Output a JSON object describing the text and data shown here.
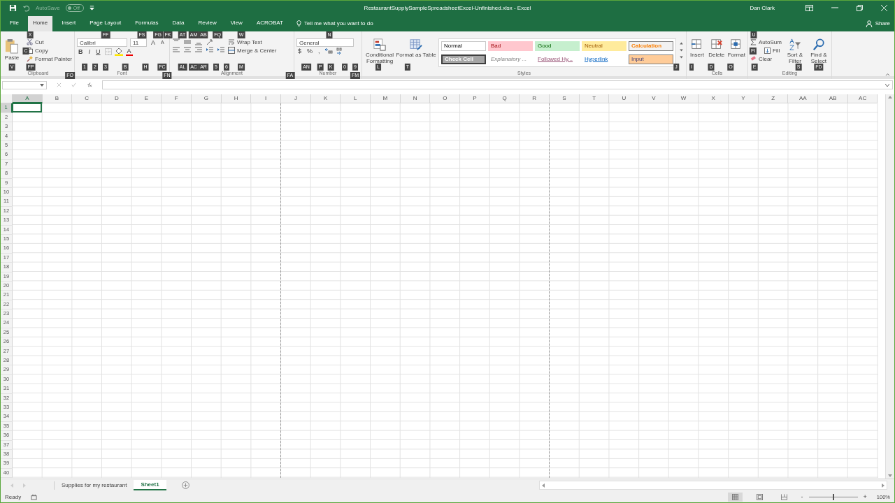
{
  "title_bar": {
    "autosave_label": "AutoSave",
    "autosave": {
      "label": "Off",
      "on": false
    },
    "title": "RestaurantSupplySampleSpreadsheetExcel-Unfinished.xlsx  -  Excel",
    "user": "Dan Clark"
  },
  "menu_tabs": [
    {
      "label": "File",
      "selected": false
    },
    {
      "label": "Home",
      "selected": true
    },
    {
      "label": "Insert",
      "selected": false
    },
    {
      "label": "Page Layout",
      "selected": false
    },
    {
      "label": "Formulas",
      "selected": false
    },
    {
      "label": "Data",
      "selected": false
    },
    {
      "label": "Review",
      "selected": false
    },
    {
      "label": "View",
      "selected": false
    },
    {
      "label": "ACROBAT",
      "selected": false
    }
  ],
  "tell_me": "Tell me what you want to do",
  "share": "Share",
  "clipboard": {
    "paste": "Paste",
    "cut": "Cut",
    "copy": "Copy",
    "format_painter": "Format Painter",
    "label": "Clipboard"
  },
  "font": {
    "name": "Calibri",
    "size": "11",
    "grow": "A",
    "shrink": "A",
    "bold": "B",
    "italic": "I",
    "underline": "U",
    "color_letter": "A",
    "label": "Font"
  },
  "alignment": {
    "wrap": "Wrap Text",
    "merge": "Merge & Center",
    "label": "Alignment"
  },
  "number": {
    "format": "General",
    "currency": "$",
    "percent": "%",
    "comma": ",",
    "label": "Number"
  },
  "styles": {
    "conditional": "Conditional Formatting",
    "format_table": "Format as Table",
    "label": "Styles",
    "gallery": [
      {
        "label": "Normal",
        "kind": "normal"
      },
      {
        "label": "Bad",
        "kind": "bad"
      },
      {
        "label": "Good",
        "kind": "good"
      },
      {
        "label": "Neutral",
        "kind": "neutral"
      },
      {
        "label": "Calculation",
        "kind": "calculation"
      },
      {
        "label": "Check Cell",
        "kind": "check"
      },
      {
        "label": "Explanatory ...",
        "kind": "explanatory"
      },
      {
        "label": "Followed Hy...",
        "kind": "followed"
      },
      {
        "label": "Hyperlink",
        "kind": "hyperlink"
      },
      {
        "label": "Input",
        "kind": "input"
      }
    ]
  },
  "cells": {
    "buttons": [
      "Insert",
      "Delete",
      "Format"
    ],
    "label": "Cells"
  },
  "editing": {
    "autosum": "AutoSum",
    "fill": "Fill",
    "clear": "Clear",
    "sort": "Sort & Filter",
    "find": "Find & Select",
    "label": "Editing"
  },
  "keytips": [
    "X",
    "C",
    "V",
    "FP",
    "FO",
    "FF",
    "FS",
    "FG",
    "FK",
    "1",
    "2",
    "3",
    "B",
    "H",
    "FC",
    "FN",
    "AT",
    "AM",
    "AB",
    "FQ",
    "W",
    "AL",
    "AC",
    "AR",
    "5",
    "6",
    "M",
    "FA",
    "N",
    "AN",
    "P",
    "K",
    "0",
    "9",
    "FM",
    "L",
    "T",
    "J",
    "I",
    "D",
    "O",
    "U",
    "FI",
    "E",
    "S",
    "FD"
  ],
  "columns": [
    {
      "label": "A",
      "selected": true,
      "page_break": false
    },
    {
      "label": "B",
      "selected": false,
      "page_break": false
    },
    {
      "label": "C",
      "selected": false,
      "page_break": false
    },
    {
      "label": "D",
      "selected": false,
      "page_break": false
    },
    {
      "label": "E",
      "selected": false,
      "page_break": false
    },
    {
      "label": "F",
      "selected": false,
      "page_break": false
    },
    {
      "label": "G",
      "selected": false,
      "page_break": false
    },
    {
      "label": "H",
      "selected": false,
      "page_break": false
    },
    {
      "label": "I",
      "selected": false,
      "page_break": true
    },
    {
      "label": "J",
      "selected": false,
      "page_break": false
    },
    {
      "label": "K",
      "selected": false,
      "page_break": false
    },
    {
      "label": "L",
      "selected": false,
      "page_break": false
    },
    {
      "label": "M",
      "selected": false,
      "page_break": false
    },
    {
      "label": "N",
      "selected": false,
      "page_break": false
    },
    {
      "label": "O",
      "selected": false,
      "page_break": false
    },
    {
      "label": "P",
      "selected": false,
      "page_break": false
    },
    {
      "label": "Q",
      "selected": false,
      "page_break": false
    },
    {
      "label": "R",
      "selected": false,
      "page_break": true
    },
    {
      "label": "S",
      "selected": false,
      "page_break": false
    },
    {
      "label": "T",
      "selected": false,
      "page_break": false
    },
    {
      "label": "U",
      "selected": false,
      "page_break": false
    },
    {
      "label": "V",
      "selected": false,
      "page_break": false
    },
    {
      "label": "W",
      "selected": false,
      "page_break": false
    },
    {
      "label": "X",
      "selected": false,
      "page_break": false
    },
    {
      "label": "Y",
      "selected": false,
      "page_break": false
    },
    {
      "label": "Z",
      "selected": false,
      "page_break": false
    },
    {
      "label": "AA",
      "selected": false,
      "page_break": false
    },
    {
      "label": "AB",
      "selected": false,
      "page_break": false
    },
    {
      "label": "AC",
      "selected": false,
      "page_break": false
    }
  ],
  "rows": [
    {
      "label": "1",
      "selected": true
    },
    {
      "label": "2",
      "selected": false
    },
    {
      "label": "3",
      "selected": false
    },
    {
      "label": "4",
      "selected": false
    },
    {
      "label": "5",
      "selected": false
    },
    {
      "label": "6",
      "selected": false
    },
    {
      "label": "7",
      "selected": false
    },
    {
      "label": "8",
      "selected": false
    },
    {
      "label": "9",
      "selected": false
    },
    {
      "label": "10",
      "selected": false
    },
    {
      "label": "11",
      "selected": false
    },
    {
      "label": "12",
      "selected": false
    },
    {
      "label": "13",
      "selected": false
    },
    {
      "label": "14",
      "selected": false
    },
    {
      "label": "15",
      "selected": false
    },
    {
      "label": "16",
      "selected": false
    },
    {
      "label": "17",
      "selected": false
    },
    {
      "label": "18",
      "selected": false
    },
    {
      "label": "19",
      "selected": false
    },
    {
      "label": "20",
      "selected": false
    },
    {
      "label": "21",
      "selected": false
    },
    {
      "label": "22",
      "selected": false
    },
    {
      "label": "23",
      "selected": false
    },
    {
      "label": "24",
      "selected": false
    },
    {
      "label": "25",
      "selected": false
    },
    {
      "label": "26",
      "selected": false
    },
    {
      "label": "27",
      "selected": false
    },
    {
      "label": "28",
      "selected": false
    },
    {
      "label": "29",
      "selected": false
    },
    {
      "label": "30",
      "selected": false
    },
    {
      "label": "31",
      "selected": false
    },
    {
      "label": "32",
      "selected": false
    },
    {
      "label": "33",
      "selected": false
    },
    {
      "label": "34",
      "selected": false
    },
    {
      "label": "35",
      "selected": false
    },
    {
      "label": "36",
      "selected": false
    },
    {
      "label": "37",
      "selected": false
    },
    {
      "label": "38",
      "selected": false
    },
    {
      "label": "39",
      "selected": false
    },
    {
      "label": "40",
      "selected": false
    }
  ],
  "sheet_tabs": [
    {
      "label": "Supplies for my restaurant",
      "selected": false
    },
    {
      "label": "Sheet1",
      "selected": true
    }
  ],
  "status_bar": {
    "status": "Ready",
    "zoom_minus": "-",
    "zoom_plus": "+",
    "zoom": "100%",
    "zoom_slider": {
      "level": 0.5
    }
  }
}
